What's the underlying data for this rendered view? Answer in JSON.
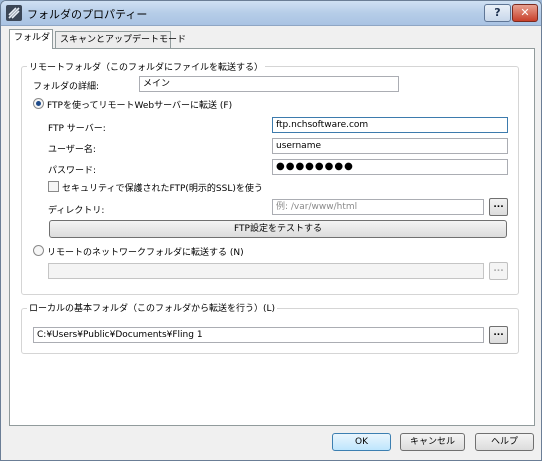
{
  "window": {
    "title": "フォルダのプロパティー",
    "help_label": "?",
    "close_label": "✕"
  },
  "tabs": [
    {
      "label": "フォルダ",
      "selected": true
    },
    {
      "label": "スキャンとアップデートモード",
      "selected": false
    }
  ],
  "remote": {
    "legend": "リモートフォルダ（このフォルダにファイルを転送する）",
    "details_label": "フォルダの詳細:",
    "details_value": "メイン",
    "ftp_option_label": "FTPを使ってリモートWebサーバーに転送 (F)",
    "ftp_selected": true,
    "server_label": "FTP サーバー:",
    "server_value": "ftp.nchsoftware.com",
    "username_label": "ユーザー名:",
    "username_value": "username",
    "password_label": "パスワード:",
    "password_value": "●●●●●●●●",
    "secure_label": "セキュリティで保護されたFTP(明示的SSL)を使う",
    "secure_checked": false,
    "directory_label": "ディレクトリ:",
    "directory_placeholder": "例: /var/www/html",
    "browse_label": "...",
    "test_button": "FTP設定をテストする",
    "network_option_label": "リモートのネットワークフォルダに転送する (N)",
    "network_selected": false,
    "network_value": "",
    "network_browse_label": "..."
  },
  "local": {
    "legend": "ローカルの基本フォルダ（このフォルダから転送を行う）(L)",
    "path_value": "C:¥Users¥Public¥Documents¥Fling 1",
    "browse_label": "..."
  },
  "footer": {
    "ok": "OK",
    "cancel": "キャンセル",
    "help": "ヘルプ"
  }
}
